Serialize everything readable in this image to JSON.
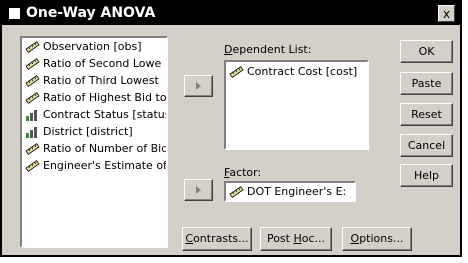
{
  "window": {
    "title": "One-Way ANOVA",
    "close_glyph": "x"
  },
  "variables": [
    {
      "label": "Observation [obs]",
      "icon": "scale-ruler-icon"
    },
    {
      "label": "Ratio of Second Lowe",
      "icon": "scale-ruler-icon"
    },
    {
      "label": "Ratio of Third Lowest",
      "icon": "scale-ruler-icon"
    },
    {
      "label": "Ratio of Highest Bid to",
      "icon": "scale-ruler-icon"
    },
    {
      "label": "Contract Status [status",
      "icon": "bar-chart-icon"
    },
    {
      "label": "District [district]",
      "icon": "bar-chart-icon"
    },
    {
      "label": "Ratio of Number of Bid",
      "icon": "scale-ruler-icon"
    },
    {
      "label": "Engineer's Estimate of",
      "icon": "scale-ruler-icon"
    }
  ],
  "dependent": {
    "label_underlined": "D",
    "label_rest": "ependent List:",
    "items": [
      {
        "label": "Contract Cost [cost]",
        "icon": "scale-ruler-icon"
      }
    ]
  },
  "factor": {
    "label_underlined": "F",
    "label_rest": "actor:",
    "value": "DOT Engineer's E:",
    "icon": "scale-ruler-icon"
  },
  "buttons": {
    "ok": "OK",
    "paste": "Paste",
    "reset": "Reset",
    "cancel": "Cancel",
    "help": "Help",
    "contrasts_u": "C",
    "contrasts_rest": "ontrasts...",
    "posthoc_a": "Post ",
    "posthoc_u": "H",
    "posthoc_rest": "oc...",
    "options_u": "O",
    "options_rest": "ptions..."
  },
  "colors": {
    "face": "#d4d0c8",
    "titlebar": "#000000",
    "icon_green": "#3a8a3a"
  }
}
